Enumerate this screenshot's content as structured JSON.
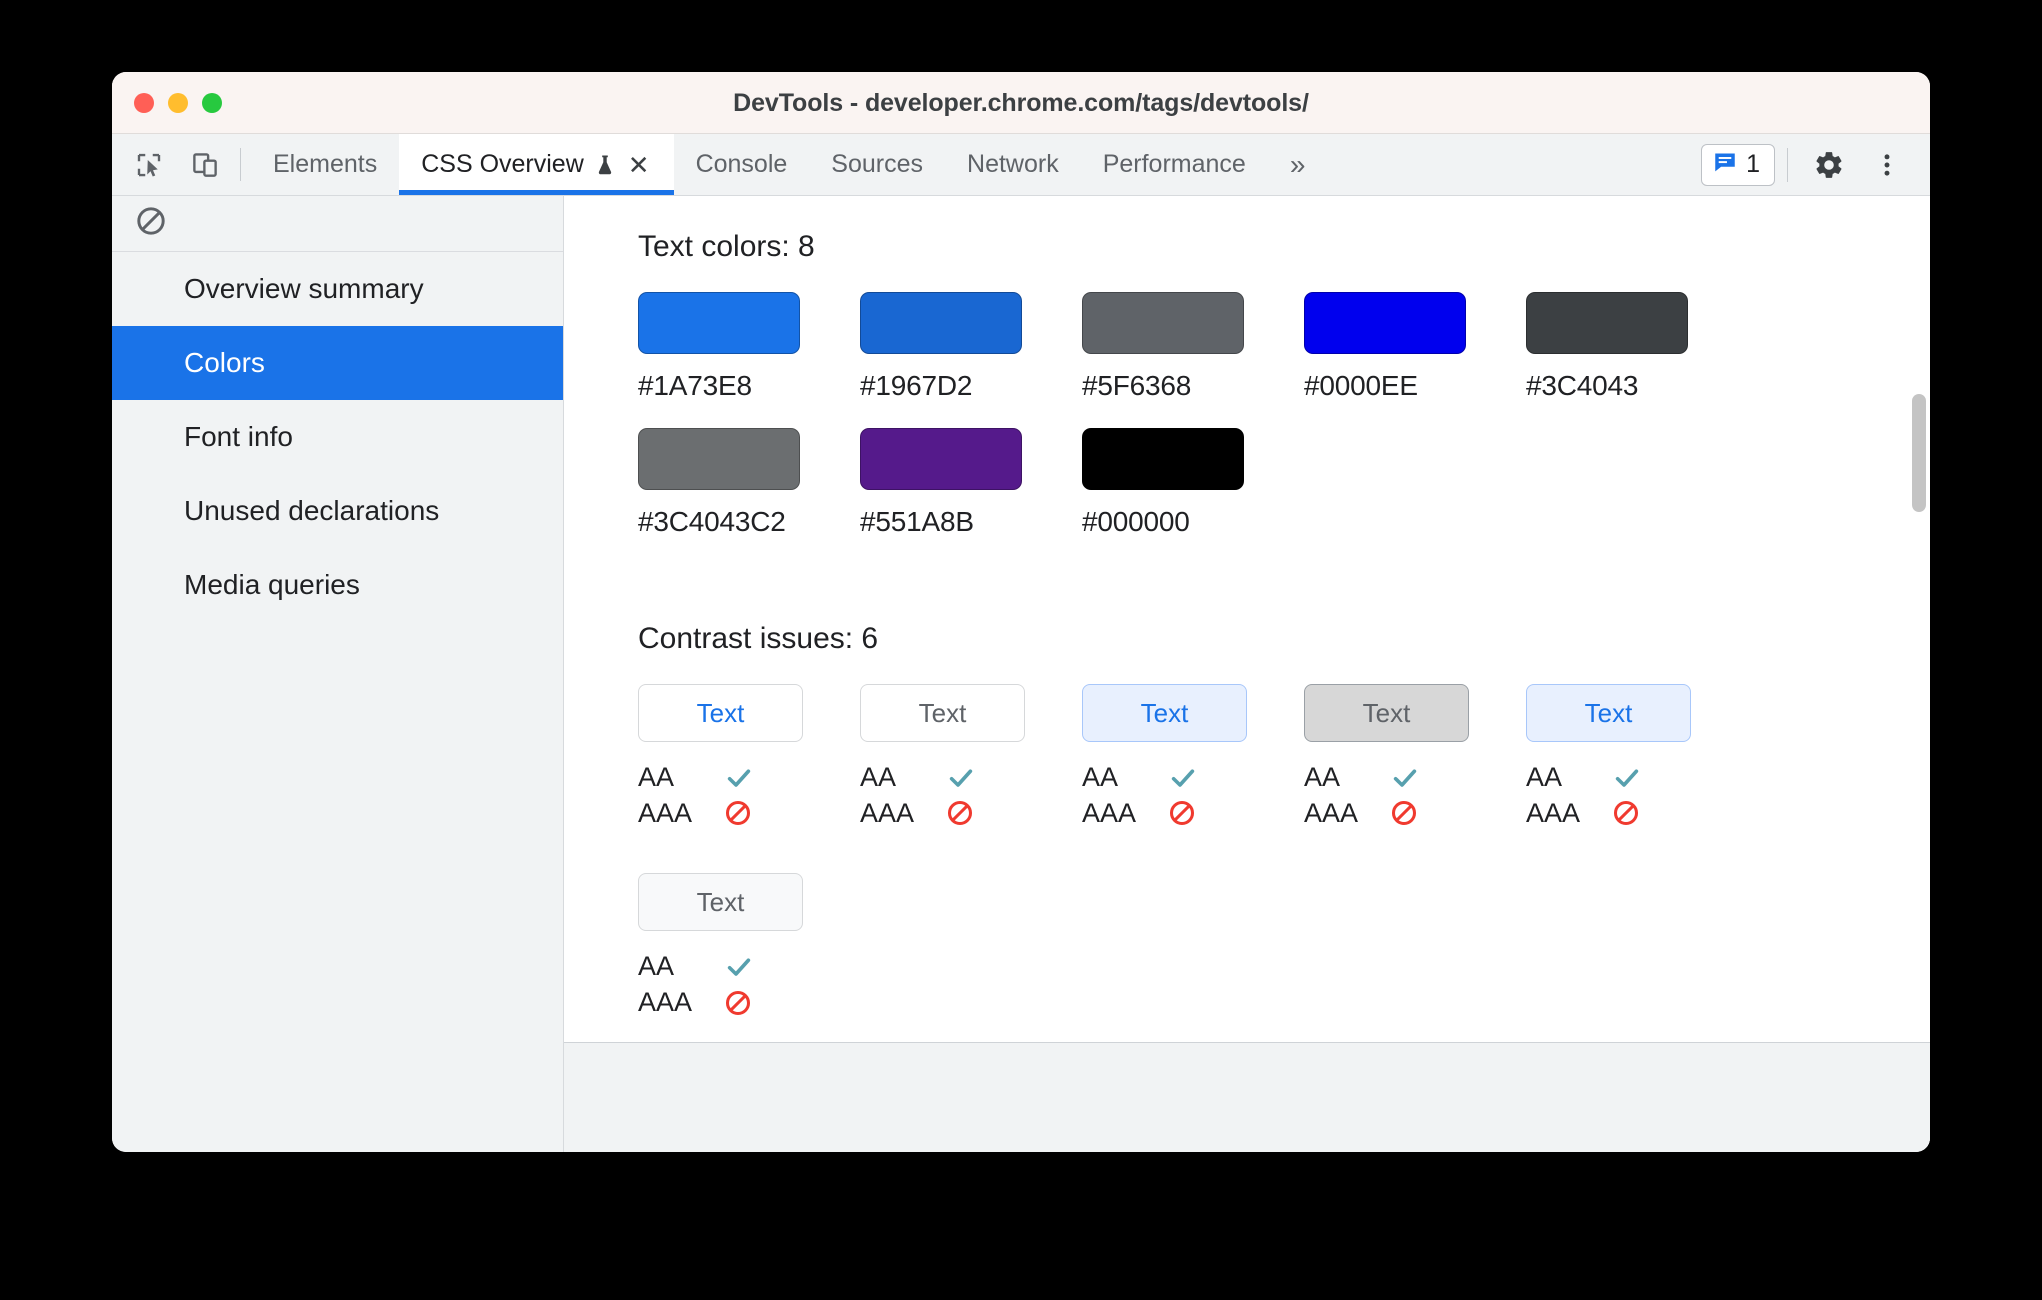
{
  "window": {
    "title": "DevTools - developer.chrome.com/tags/devtools/",
    "traffic_lights": [
      "close-red",
      "minimize-yellow",
      "zoom-green"
    ]
  },
  "tabbar": {
    "left_icons": [
      "inspect-cursor-icon",
      "device-toolbar-icon"
    ],
    "tabs": [
      {
        "label": "Elements",
        "active": false
      },
      {
        "label": "CSS Overview",
        "active": true,
        "has_flask": true,
        "has_close": true
      },
      {
        "label": "Console",
        "active": false
      },
      {
        "label": "Sources",
        "active": false
      },
      {
        "label": "Network",
        "active": false
      },
      {
        "label": "Performance",
        "active": false
      }
    ],
    "more_tabs_label": "»",
    "issues": {
      "icon": "issues-message-icon",
      "count": "1"
    },
    "settings_icon": "gear-icon",
    "more_options_icon": "kebab-menu-icon"
  },
  "sidebar": {
    "toolbar_icon": "clear-no-entry-icon",
    "items": [
      {
        "label": "Overview summary",
        "selected": false
      },
      {
        "label": "Colors",
        "selected": true
      },
      {
        "label": "Font info",
        "selected": false
      },
      {
        "label": "Unused declarations",
        "selected": false
      },
      {
        "label": "Media queries",
        "selected": false
      }
    ]
  },
  "main": {
    "text_colors": {
      "heading": "Text colors: 8",
      "swatches": [
        {
          "label": "#1A73E8",
          "color": "#1A73E8"
        },
        {
          "label": "#1967D2",
          "color": "#1967D2"
        },
        {
          "label": "#5F6368",
          "color": "#5F6368"
        },
        {
          "label": "#0000EE",
          "color": "#0000EE"
        },
        {
          "label": "#3C4043",
          "color": "#3C4043"
        },
        {
          "label": "#3C4043C2",
          "color": "#3C4043C2"
        },
        {
          "label": "#551A8B",
          "color": "#551A8B"
        },
        {
          "label": "#000000",
          "color": "#000000"
        }
      ]
    },
    "contrast_issues": {
      "heading": "Contrast issues: 6",
      "sample_text": "Text",
      "level_aa": "AA",
      "level_aaa": "AAA",
      "pass_icon": "check-icon",
      "fail_icon": "block-no-entry-icon",
      "pass_color": "#57A0AE",
      "fail_color": "#F03A2F",
      "cards": [
        {
          "bg": "#FFFFFF",
          "border": "#D6D8DA",
          "fg": "#1A73E8",
          "aa": "pass",
          "aaa": "fail"
        },
        {
          "bg": "#FFFFFF",
          "border": "#D6D8DA",
          "fg": "#5F6368",
          "aa": "pass",
          "aaa": "fail"
        },
        {
          "bg": "#E8F0FE",
          "border": "#A8C7FA",
          "fg": "#1A73E8",
          "aa": "pass",
          "aaa": "fail"
        },
        {
          "bg": "#D7D7D7",
          "border": "#9AA0A6",
          "fg": "#5F6368",
          "aa": "pass",
          "aaa": "fail"
        },
        {
          "bg": "#E8F0FE",
          "border": "#A8C7FA",
          "fg": "#1A73E8",
          "aa": "pass",
          "aaa": "fail"
        },
        {
          "bg": "#F8F9FA",
          "border": "#D6D8DA",
          "fg": "#5F6368",
          "aa": "pass",
          "aaa": "fail"
        }
      ]
    }
  }
}
